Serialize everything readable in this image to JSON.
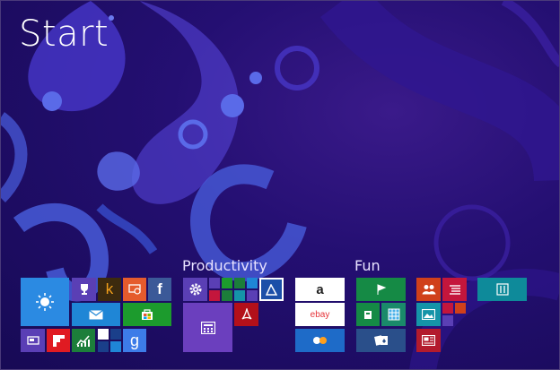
{
  "start_screen": {
    "title": "Start",
    "groups": [
      {
        "name": ""
      },
      {
        "name": "Productivity"
      },
      {
        "name": "Fun"
      }
    ],
    "tiles": {
      "weather": {
        "icon": "sun-icon",
        "color": "#2b8ae2"
      },
      "achievements": {
        "icon": "trophy-icon",
        "color": "#5a3fb5"
      },
      "kindle": {
        "label": "k",
        "color": "#3c2a0e"
      },
      "remote_desktop": {
        "icon": "remote-desktop-icon",
        "color": "#e55b2d"
      },
      "facebook": {
        "label": "f",
        "color": "#3b5998"
      },
      "mail": {
        "icon": "mail-icon",
        "color": "#1f86d6"
      },
      "store": {
        "icon": "store-icon",
        "color": "#1c9b2d"
      },
      "desktop": {
        "icon": "desktop-icon",
        "color": "#5a3fb5"
      },
      "flipboard": {
        "icon": "flipboard-icon",
        "color": "#e01b22"
      },
      "finance": {
        "icon": "finance-icon",
        "color": "#1c7e3a"
      },
      "google": {
        "label": "g",
        "color": "#3d7ce8"
      },
      "settings": {
        "icon": "gear-icon",
        "color": "#5a3fb5"
      },
      "nfc_app": {
        "icon": "nfc-icon",
        "color": "#1b4fa8"
      },
      "calculator": {
        "icon": "calculator-icon",
        "color": "#6b3fbe"
      },
      "pdf_reader": {
        "icon": "pdf-icon",
        "color": "#b3101a"
      },
      "amazon": {
        "label": "a",
        "color": "#ffffff"
      },
      "ebay": {
        "label": "ebay",
        "color": "#ffffff"
      },
      "flickr": {
        "icon": "flickr-icon",
        "color": "#1e6bc8"
      },
      "game_1": {
        "icon": "game-icon",
        "color": "#158a45"
      },
      "game_2": {
        "icon": "game-icon",
        "color": "#158a45"
      },
      "mahjong": {
        "icon": "mahjong-icon",
        "color": "#1a8a6a"
      },
      "solitaire": {
        "icon": "cards-icon",
        "color": "#2a4f8a"
      },
      "people": {
        "icon": "people-icon",
        "color": "#d0401a"
      },
      "reading_list": {
        "icon": "reading-list-icon",
        "color": "#c4163c"
      },
      "photos": {
        "icon": "photos-icon",
        "color": "#1594a8"
      },
      "news": {
        "icon": "news-icon",
        "color": "#b31b2d"
      },
      "food_drink": {
        "icon": "food-drink-icon",
        "color": "#0e8a9a"
      }
    }
  }
}
